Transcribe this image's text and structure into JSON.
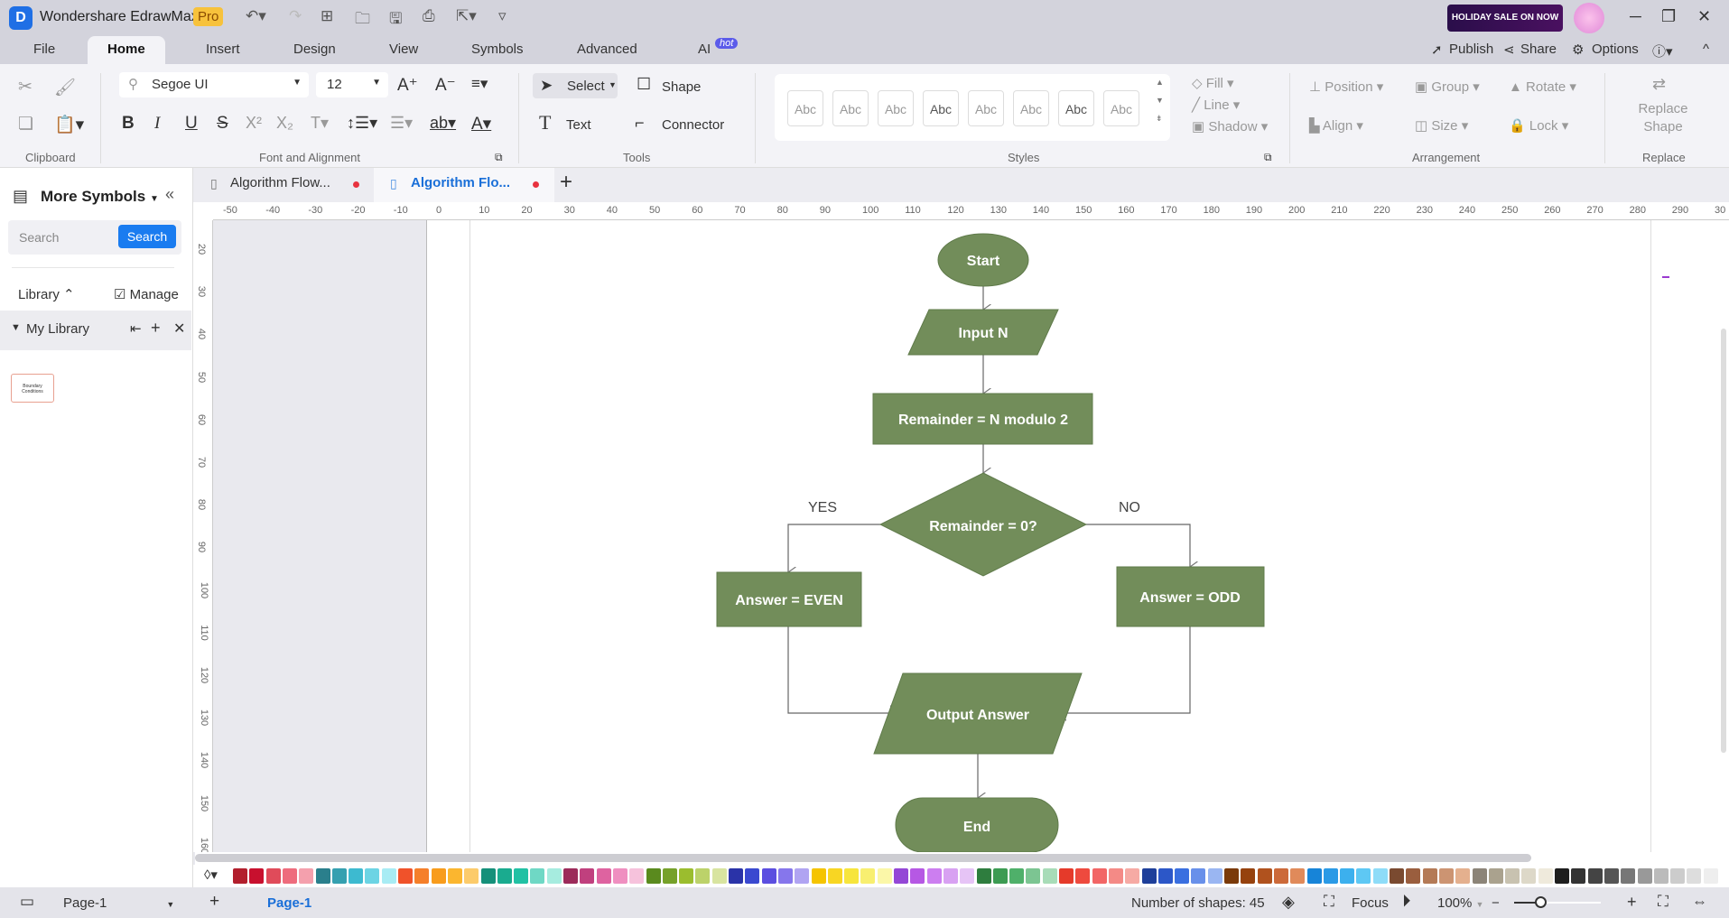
{
  "app": {
    "title": "Wondershare EdrawMax",
    "badge": "Pro",
    "sale": "HOLIDAY SALE ON NOW"
  },
  "menu": {
    "tabs": [
      "File",
      "Home",
      "Insert",
      "Design",
      "View",
      "Symbols",
      "Advanced",
      "AI"
    ],
    "hot": "hot",
    "publish": "Publish",
    "share": "Share",
    "options": "Options"
  },
  "ribbon": {
    "font": "Segoe UI",
    "size": "12",
    "select": "Select",
    "shape": "Shape",
    "text": "Text",
    "connector": "Connector",
    "styles": [
      "Abc",
      "Abc",
      "Abc",
      "Abc",
      "Abc",
      "Abc",
      "Abc",
      "Abc"
    ],
    "fill": "Fill",
    "line": "Line",
    "shadow": "Shadow",
    "position": "Position",
    "group": "Group",
    "rotate": "Rotate",
    "align": "Align",
    "size_btn": "Size",
    "lock": "Lock",
    "replace_shape": "Replace Shape",
    "groups": {
      "clipboard": "Clipboard",
      "font": "Font and Alignment",
      "tools": "Tools",
      "styles": "Styles",
      "arrangement": "Arrangement",
      "replace": "Replace"
    }
  },
  "doc_tabs": [
    {
      "label": "Algorithm Flow..."
    },
    {
      "label": "Algorithm Flo..."
    }
  ],
  "sidebar": {
    "title": "More Symbols",
    "search_placeholder": "Search",
    "search_button": "Search",
    "library": "Library",
    "manage": "Manage",
    "my_library": "My Library",
    "thumb": "Boundary Conditions"
  },
  "ruler": {
    "h": [
      "-50",
      "-40",
      "-30",
      "-20",
      "-10",
      "0",
      "10",
      "20",
      "30",
      "40",
      "50",
      "60",
      "70",
      "80",
      "90",
      "100",
      "110",
      "120",
      "130",
      "140",
      "150",
      "160",
      "170",
      "180",
      "190",
      "200",
      "210",
      "220",
      "230",
      "240",
      "250",
      "260",
      "270",
      "280",
      "290",
      "30"
    ],
    "v": [
      "20",
      "30",
      "40",
      "50",
      "60",
      "70",
      "80",
      "90",
      "100",
      "110",
      "120",
      "130",
      "140",
      "150",
      "160"
    ]
  },
  "flowchart": {
    "fill": "#728d5a",
    "start": "Start",
    "input": "Input N",
    "process": "Remainder = N modulo 2",
    "decision": "Remainder = 0?",
    "yes": "YES",
    "no": "NO",
    "even": "Answer = EVEN",
    "odd": "Answer = ODD",
    "output": "Output Answer",
    "end": "End"
  },
  "palette": [
    "#b21f2d",
    "#c8102e",
    "#e04b5a",
    "#ee6c7d",
    "#f4a0ad",
    "#2a7f8c",
    "#35a0b0",
    "#3dbad0",
    "#6cd4e4",
    "#a8ecf4",
    "#f0522a",
    "#f57f2a",
    "#f89c1c",
    "#fbb62f",
    "#fccb6b",
    "#15907a",
    "#1aab8f",
    "#22c1a4",
    "#6fd8c5",
    "#a6ecdf",
    "#9c2a5a",
    "#c0407e",
    "#de63a0",
    "#ef8fc0",
    "#f6c2dc",
    "#5a8a1e",
    "#76a12a",
    "#9bbd2e",
    "#bcd26a",
    "#d8e4a0",
    "#2a33a8",
    "#3a49d0",
    "#5b4ee0",
    "#8676ec",
    "#b0a4f2",
    "#f5c400",
    "#f8d623",
    "#f7e53c",
    "#f8ef70",
    "#fbf7a8",
    "#9447d6",
    "#b658e4",
    "#cc7ef0",
    "#d8a1f2",
    "#e6c4f6",
    "#2e7d3e",
    "#3c9b52",
    "#4fb06a",
    "#7cc592",
    "#a8dcb8",
    "#e53a2a",
    "#ee4a3e",
    "#f26666",
    "#f48a86",
    "#f6aaa4",
    "#1e3f9a",
    "#2c57c8",
    "#3a6fe0",
    "#6890ea",
    "#9ab6f2",
    "#7a3a0a",
    "#96420e",
    "#b0521e",
    "#cc6a3a",
    "#e08a5a",
    "#1784d8",
    "#2a9ae6",
    "#3cb0ee",
    "#5ec8f4",
    "#8edcf8",
    "#7a4a30",
    "#9a5e3e",
    "#b47a56",
    "#cc9472",
    "#e4b08e",
    "#8c8478",
    "#aaa28e",
    "#c8c2b0",
    "#ddd8c8",
    "#efeadc",
    "#1e1e1e",
    "#333333",
    "#444444",
    "#555555",
    "#777777",
    "#999999",
    "#bbbbbb",
    "#cccccc",
    "#dddddd",
    "#eeeeee"
  ],
  "status": {
    "page_tab": "Page-1",
    "page_active": "Page-1",
    "shapes": "Number of shapes: 45",
    "focus": "Focus",
    "zoom": "100%",
    "zoom_level": 0.3
  }
}
